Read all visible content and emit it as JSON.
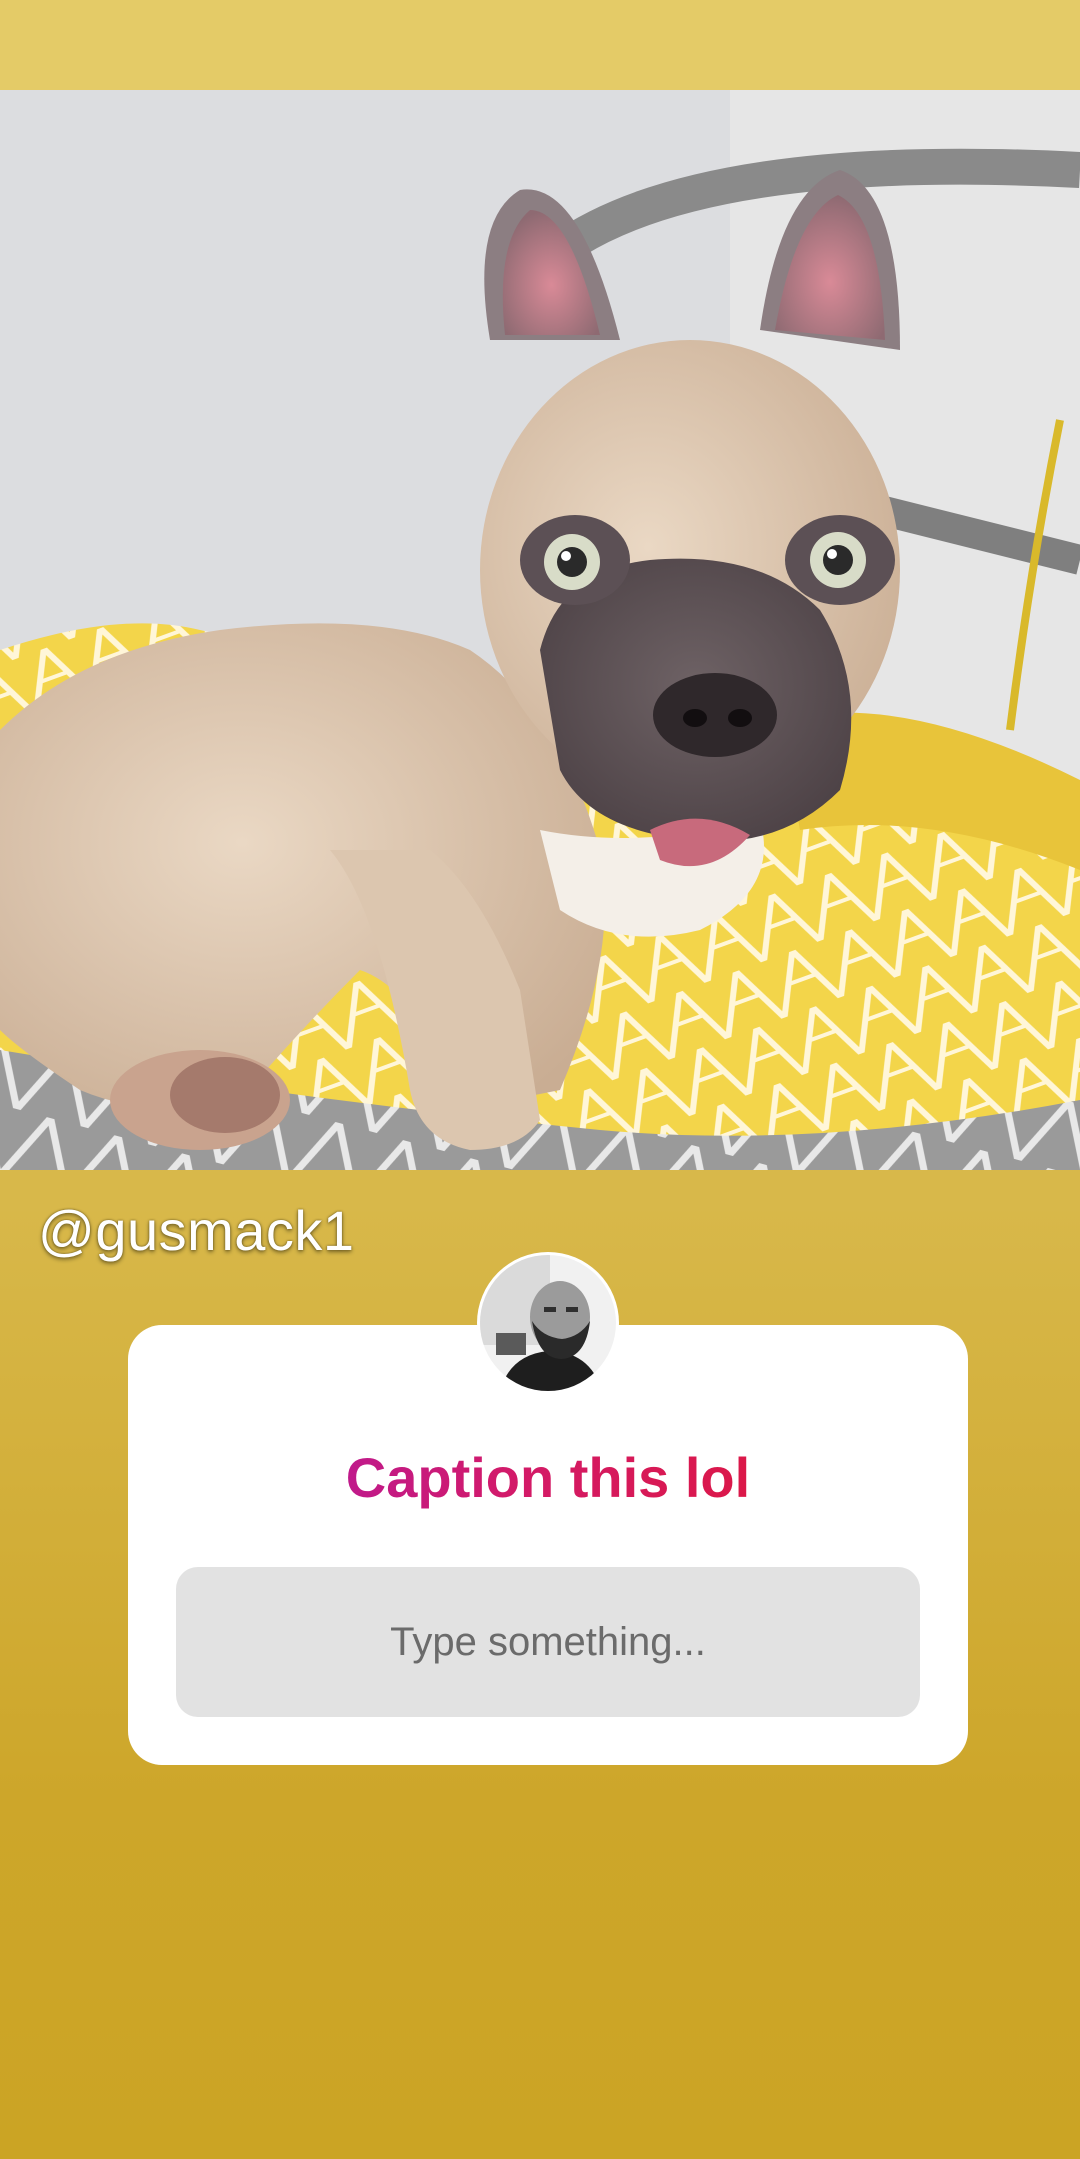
{
  "story": {
    "username": "@gusmack1",
    "question_sticker": {
      "prompt": "Caption this lol",
      "placeholder": "Type something..."
    }
  },
  "colors": {
    "background_top": "#e3c964",
    "background_bottom": "#cba424",
    "prompt_gradient_start": "#a61bb8",
    "prompt_gradient_end": "#e3162a"
  }
}
